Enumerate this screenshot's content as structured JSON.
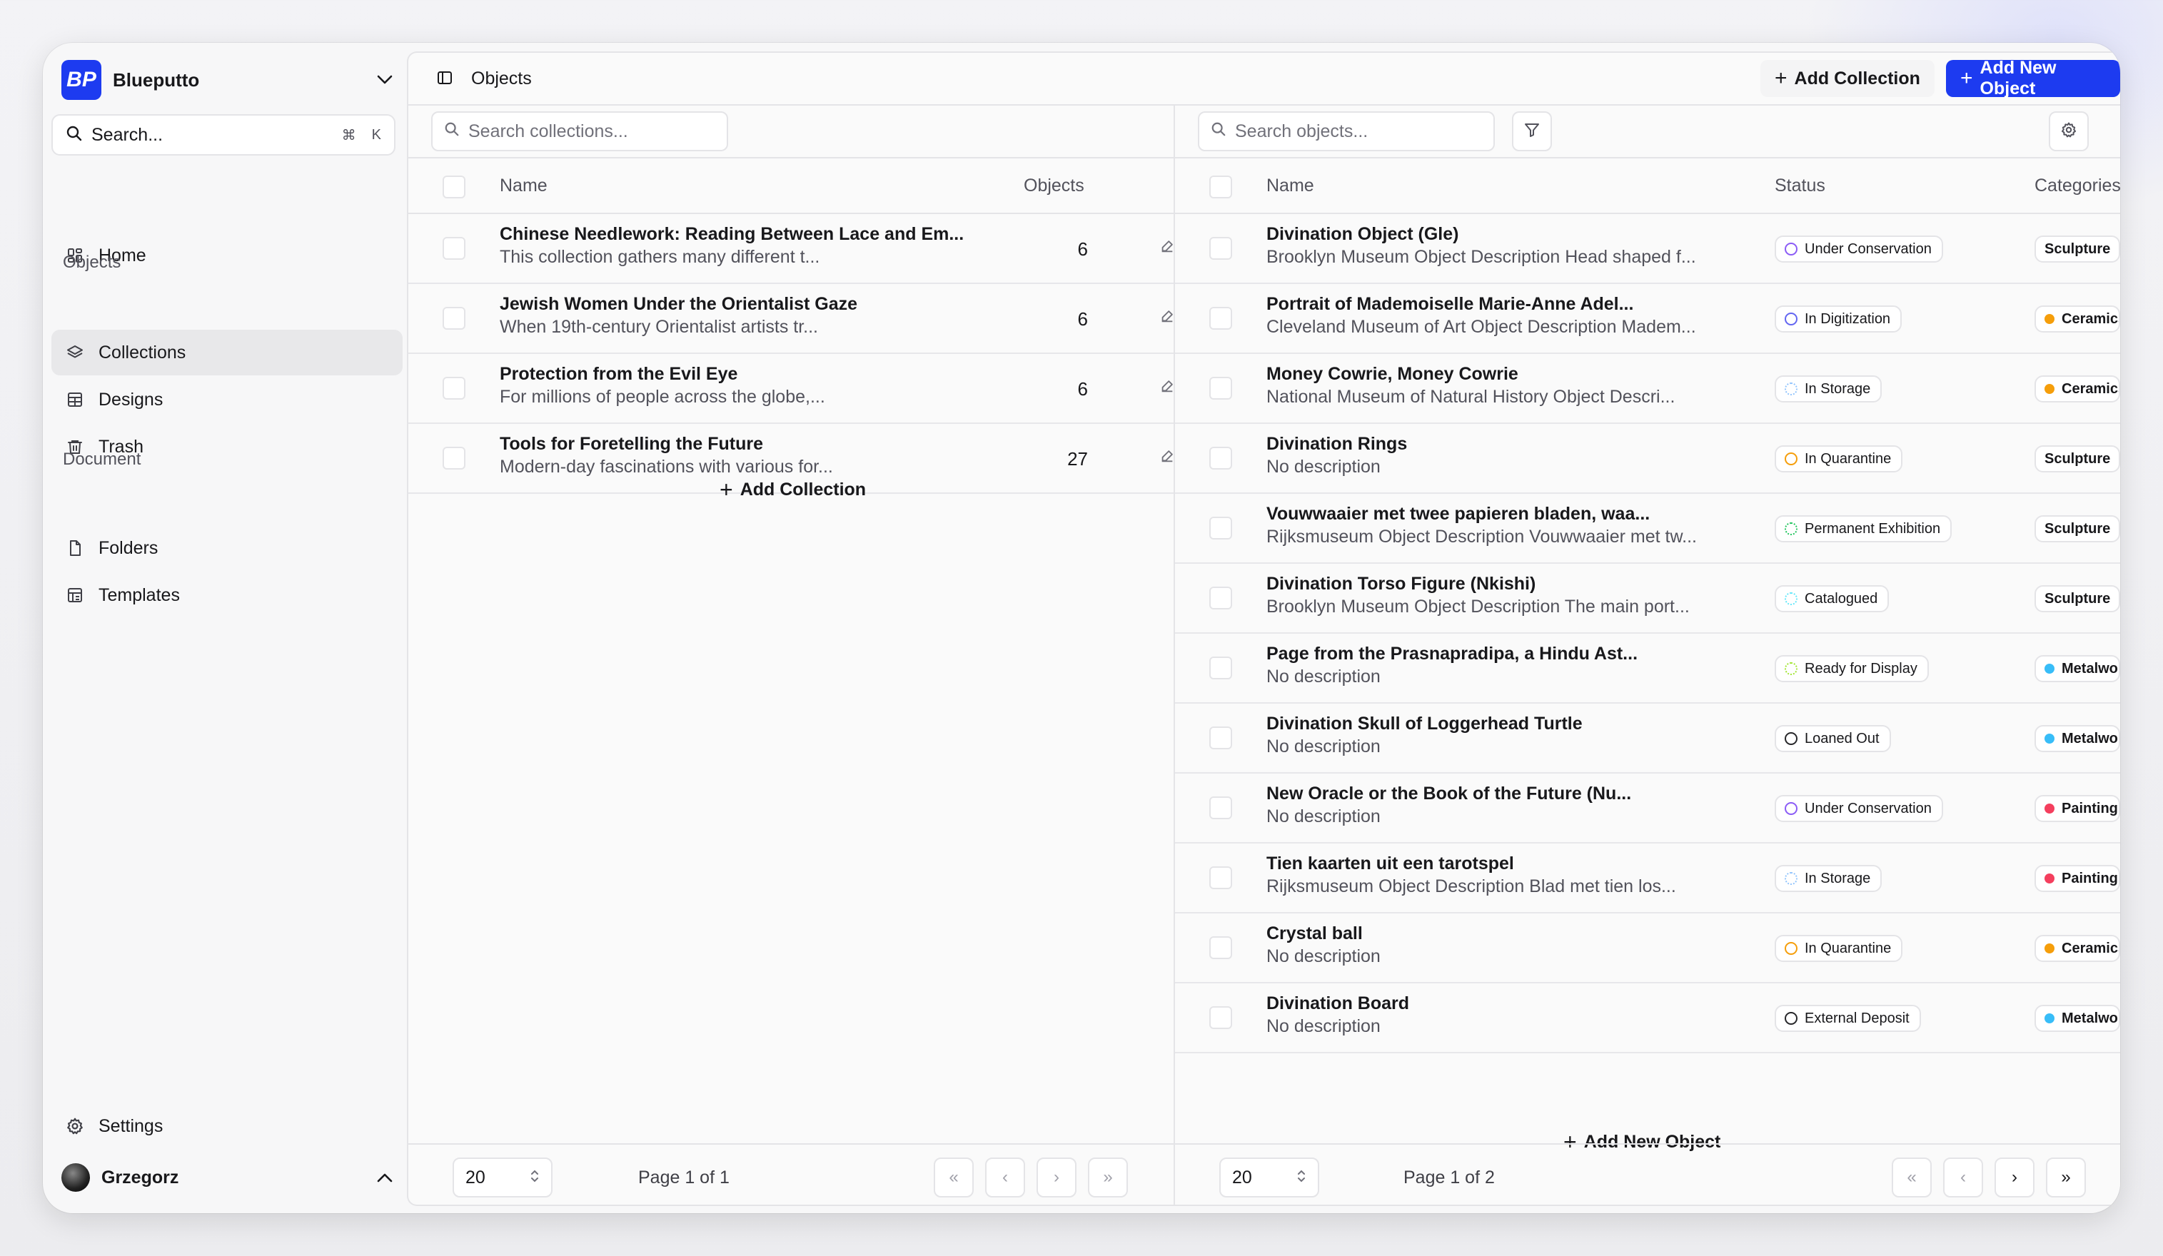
{
  "workspace": {
    "name": "Blueputto",
    "logo_text": "BP"
  },
  "sidebar": {
    "search_label": "Search...",
    "shortcut_cmd": "⌘",
    "shortcut_key": "K",
    "home": "Home",
    "section_objects": "Objects",
    "collections": "Collections",
    "designs": "Designs",
    "trash": "Trash",
    "section_document": "Document",
    "folders": "Folders",
    "templates": "Templates",
    "settings": "Settings",
    "user": "Grzegorz"
  },
  "header": {
    "breadcrumb": "Objects",
    "add_collection": "Add Collection",
    "add_new_object": "Add New Object"
  },
  "collections": {
    "search_placeholder": "Search collections...",
    "col_name": "Name",
    "col_objects": "Objects",
    "rows": [
      {
        "title": "Chinese Needlework: Reading Between Lace and Em...",
        "desc": "This collection gathers many different t...",
        "count": "6"
      },
      {
        "title": "Jewish Women Under the Orientalist Gaze",
        "desc": "When 19th-century Orientalist artists tr...",
        "count": "6"
      },
      {
        "title": "Protection from the Evil Eye",
        "desc": "For millions of people across the globe,...",
        "count": "6"
      },
      {
        "title": "Tools for Foretelling the Future",
        "desc": "Modern-day fascinations with various for...",
        "count": "27"
      }
    ],
    "add_label": "Add Collection",
    "page_size": "20",
    "page_info": "Page 1 of 1"
  },
  "objects": {
    "search_placeholder": "Search objects...",
    "col_name": "Name",
    "col_status": "Status",
    "col_categories": "Categories",
    "rows": [
      {
        "title": "Divination Object (Gle)",
        "desc": "Brooklyn Museum Object Description Head shaped f...",
        "status": "Under Conservation",
        "status_color": "#8b5cf6",
        "category": "Sculpture",
        "cat_color": ""
      },
      {
        "title": "Portrait of Mademoiselle Marie-Anne Adel...",
        "desc": "Cleveland Museum of Art Object Description Madem...",
        "status": "In Digitization",
        "status_color": "#6366f1",
        "category": "Ceramics",
        "cat_color": "#f59e0b"
      },
      {
        "title": "Money Cowrie, Money Cowrie",
        "desc": "National Museum of Natural History Object Descri...",
        "status": "In Storage",
        "status_color": "#93c5fd",
        "category": "Ceramics",
        "cat_color": "#f59e0b"
      },
      {
        "title": "Divination Rings",
        "desc": "No description",
        "status": "In Quarantine",
        "status_color": "#f59e0b",
        "category": "Sculpture",
        "cat_color": ""
      },
      {
        "title": "Vouwwaaier met twee papieren bladen, waa...",
        "desc": "Rijksmuseum Object Description Vouwwaaier met tw...",
        "status": "Permanent Exhibition",
        "status_color": "#22c55e",
        "category": "Sculpture",
        "cat_color": ""
      },
      {
        "title": "Divination Torso Figure (Nkishi)",
        "desc": "Brooklyn Museum Object Description The main port...",
        "status": "Catalogued",
        "status_color": "#67e8f9",
        "category": "Sculpture",
        "cat_color": ""
      },
      {
        "title": "Page from the Prasnapradipa, a Hindu Ast...",
        "desc": "No description",
        "status": "Ready for Display",
        "status_color": "#a3e635",
        "category": "Metalwork",
        "cat_color": "#38bdf8"
      },
      {
        "title": "Divination Skull of Loggerhead Turtle",
        "desc": "No description",
        "status": "Loaned Out",
        "status_color": "#27272a",
        "category": "Metalwork",
        "cat_color": "#38bdf8"
      },
      {
        "title": "New Oracle or the Book of the Future (Nu...",
        "desc": "No description",
        "status": "Under Conservation",
        "status_color": "#8b5cf6",
        "category": "Painting",
        "cat_color": "#f43f5e"
      },
      {
        "title": "Tien kaarten uit een tarotspel",
        "desc": "Rijksmuseum Object Description Blad met tien los...",
        "status": "In Storage",
        "status_color": "#93c5fd",
        "category": "Painting",
        "cat_color": "#f43f5e"
      },
      {
        "title": "Crystal ball",
        "desc": "No description",
        "status": "In Quarantine",
        "status_color": "#f59e0b",
        "category": "Ceramics",
        "cat_color": "#f59e0b"
      },
      {
        "title": "Divination Board",
        "desc": "No description",
        "status": "External Deposit",
        "status_color": "#27272a",
        "category": "Metalwork",
        "cat_color": "#38bdf8"
      }
    ],
    "add_label": "Add New Object",
    "page_size": "20",
    "page_info": "Page 1 of 2"
  },
  "colors": {
    "accent": "#1d3bf0"
  }
}
